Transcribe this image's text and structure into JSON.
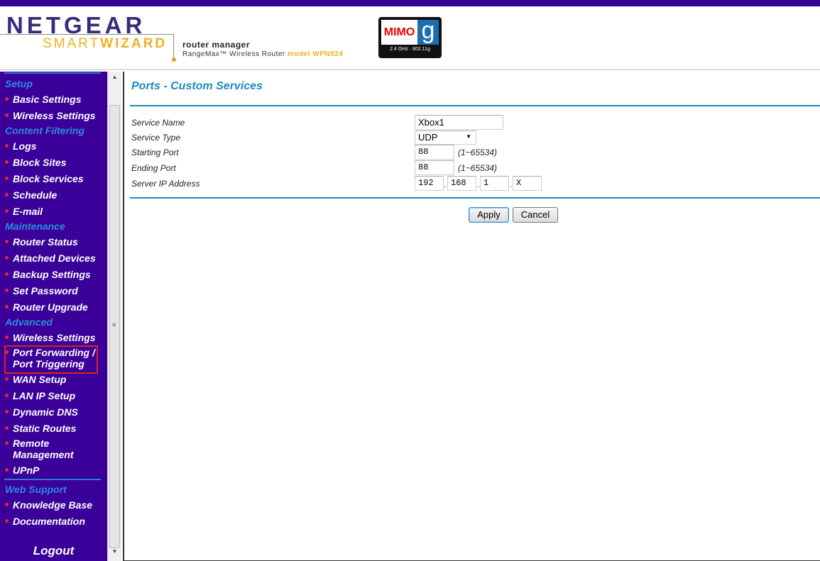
{
  "header": {
    "brand": "NETGEAR",
    "smart": "SMART",
    "wizard": "WIZARD",
    "router_manager": "router manager",
    "product": "RangeMax™ Wireless Router",
    "model": "model WPN824",
    "badge": {
      "mimo": "MIMO",
      "g": "g",
      "freq": "2.4 GHz · 802.11g"
    }
  },
  "sidebar": {
    "sections": [
      {
        "label": "Setup",
        "items": [
          "Basic Settings",
          "Wireless Settings"
        ]
      },
      {
        "label": "Content Filtering",
        "items": [
          "Logs",
          "Block Sites",
          "Block Services",
          "Schedule",
          "E-mail"
        ]
      },
      {
        "label": "Maintenance",
        "items": [
          "Router Status",
          "Attached Devices",
          "Backup Settings",
          "Set Password",
          "Router Upgrade"
        ]
      },
      {
        "label": "Advanced",
        "items": [
          "Wireless Settings",
          "Port Forwarding / Port Triggering",
          "WAN Setup",
          "LAN IP Setup",
          "Dynamic DNS",
          "Static Routes",
          "Remote Management",
          "UPnP"
        ]
      },
      {
        "label": "Web Support",
        "items": [
          "Knowledge Base",
          "Documentation"
        ]
      }
    ],
    "highlighted": "Port Forwarding / Port Triggering",
    "logout": "Logout"
  },
  "form": {
    "title": "Ports - Custom Services",
    "service_name": {
      "label": "Service Name",
      "value": "Xbox1"
    },
    "service_type": {
      "label": "Service Type",
      "value": "UDP"
    },
    "starting_port": {
      "label": "Starting Port",
      "value": "88",
      "hint": "(1~65534)"
    },
    "ending_port": {
      "label": "Ending Port",
      "value": "88",
      "hint": "(1~65534)"
    },
    "server_ip": {
      "label": "Server IP Address",
      "octets": [
        "192",
        "168",
        "1",
        "X"
      ],
      "separator": "."
    },
    "apply": "Apply",
    "cancel": "Cancel"
  },
  "colors": {
    "sidebar": "#3a0099",
    "accent": "#1a8cc0",
    "highlight": "#e02020"
  }
}
